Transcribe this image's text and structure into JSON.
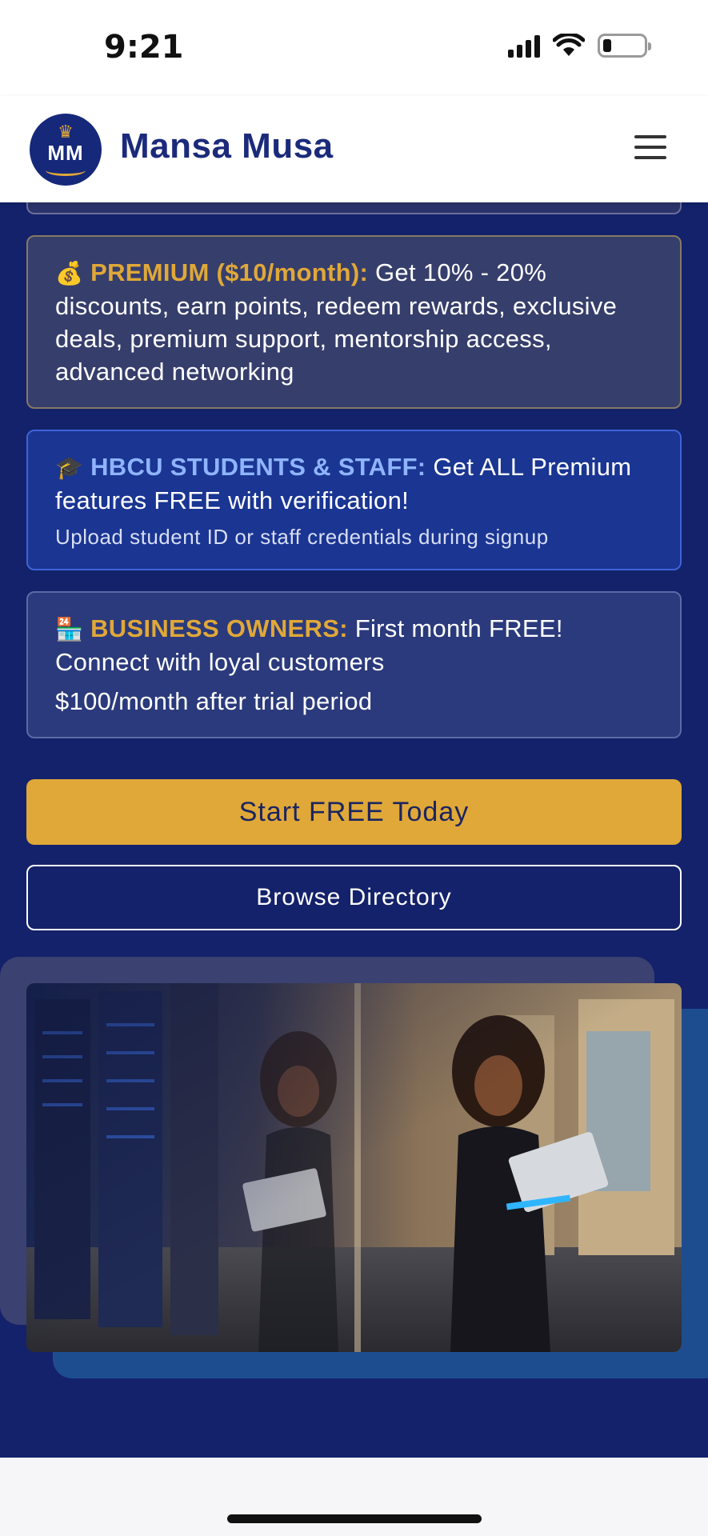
{
  "status_bar": {
    "time": "9:21",
    "icons": [
      "signal-icon",
      "wifi-icon",
      "battery-icon"
    ]
  },
  "header": {
    "logo_initials": "MM",
    "brand_name": "Mansa Musa",
    "menu_icon": "hamburger-menu-icon"
  },
  "colors": {
    "brand_navy": "#14226b",
    "accent_gold": "#e0a838",
    "hbcu_blue": "#1a3592",
    "label_blue": "#8fb4ff"
  },
  "tiers": {
    "premium": {
      "emoji": "💰",
      "label": "PREMIUM ($10/month):",
      "text": " Get 10% - 20% discounts, earn points, redeem rewards, exclusive deals, premium support, mentorship access, advanced networking"
    },
    "hbcu": {
      "emoji": "🎓",
      "label": "HBCU STUDENTS & STAFF:",
      "text": " Get ALL Premium features FREE with verification!",
      "note": "Upload student ID or staff credentials during signup"
    },
    "business": {
      "emoji": "🏪",
      "label": "BUSINESS OWNERS:",
      "text": " First month FREE! Connect with loyal customers",
      "price_note": "$100/month after trial period"
    }
  },
  "actions": {
    "primary_label": "Start FREE Today",
    "secondary_label": "Browse Directory"
  }
}
